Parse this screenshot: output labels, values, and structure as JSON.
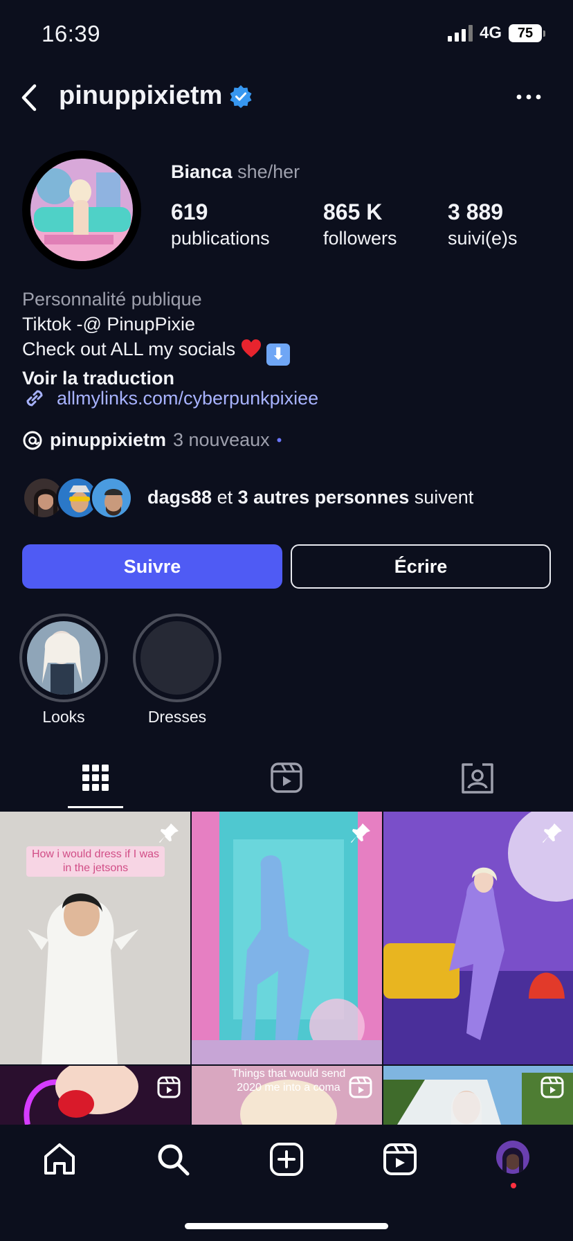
{
  "status": {
    "time": "16:39",
    "network": "4G",
    "battery": "75"
  },
  "header": {
    "username": "pinuppixietm",
    "verified_icon": "verified-badge-icon",
    "back_icon": "chevron-left-icon",
    "more_icon": "more-horizontal-icon"
  },
  "profile": {
    "name": "Bianca",
    "pronouns": "she/her",
    "stats": [
      {
        "value": "619",
        "label": "publications"
      },
      {
        "value": "865 K",
        "label": "followers"
      },
      {
        "value": "3 889",
        "label": "suivi(e)s"
      }
    ],
    "category": "Personnalité publique",
    "bio_line1": "Tiktok -@ PinupPixie",
    "bio_line2": "Check out ALL my socials",
    "translate": "Voir la traduction",
    "link": "allmylinks.com/cyberpunkpixiee",
    "threads_handle": "pinuppixietm",
    "threads_new": "3 nouveaux",
    "threads_dot": "•"
  },
  "followed_by": {
    "user": "dags88",
    "connector": "et",
    "others": "3 autres personnes",
    "suffix": "suivent"
  },
  "actions": {
    "follow": "Suivre",
    "message": "Écrire"
  },
  "highlights": [
    {
      "label": "Looks"
    },
    {
      "label": "Dresses"
    }
  ],
  "tabs": [
    {
      "icon": "grid-icon"
    },
    {
      "icon": "reels-icon"
    },
    {
      "icon": "tagged-icon"
    }
  ],
  "posts": {
    "caption1": "How i would dress if I was in the jetsons",
    "caption2": "Things that would send 2020 me into a coma"
  },
  "nav": [
    {
      "icon": "home-icon"
    },
    {
      "icon": "search-icon"
    },
    {
      "icon": "create-icon"
    },
    {
      "icon": "reels-icon"
    },
    {
      "icon": "profile-avatar"
    }
  ],
  "colors": {
    "background": "#0c0f1d",
    "accent": "#4f5bf4",
    "link": "#a8b3ff",
    "verified": "#3797f0"
  }
}
